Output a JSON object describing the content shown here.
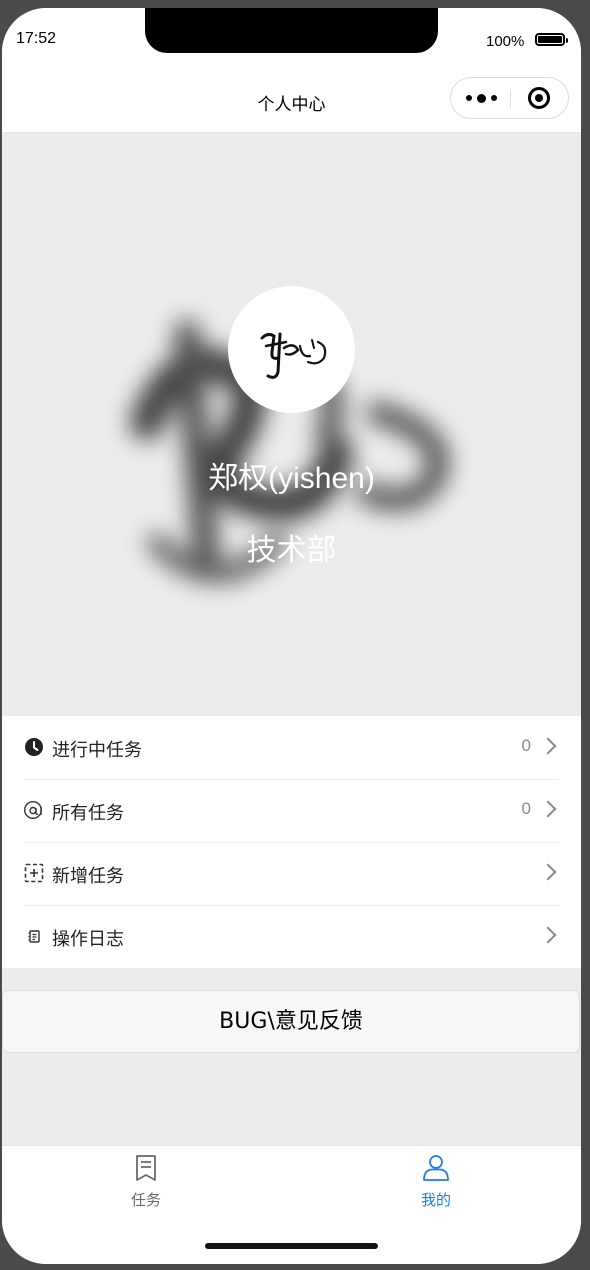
{
  "status_bar": {
    "time": "17:52",
    "battery_percent": "100%"
  },
  "navbar": {
    "title": "个人中心"
  },
  "profile": {
    "name": "郑权(yishen)",
    "department": "技术部"
  },
  "menu": [
    {
      "label": "进行中任务",
      "count": "0",
      "icon": "clock-icon"
    },
    {
      "label": "所有任务",
      "count": "0",
      "icon": "at-icon"
    },
    {
      "label": "新增任务",
      "count": "",
      "icon": "add-square-icon"
    },
    {
      "label": "操作日志",
      "count": "",
      "icon": "log-icon"
    }
  ],
  "feedback": {
    "label": "BUG\\意见反馈"
  },
  "tabbar": {
    "tasks": {
      "label": "任务",
      "icon": "document-icon",
      "active": false
    },
    "mine": {
      "label": "我的",
      "icon": "person-icon",
      "active": true
    }
  },
  "colors": {
    "accent": "#1e7fe6",
    "background": "#ededed"
  }
}
